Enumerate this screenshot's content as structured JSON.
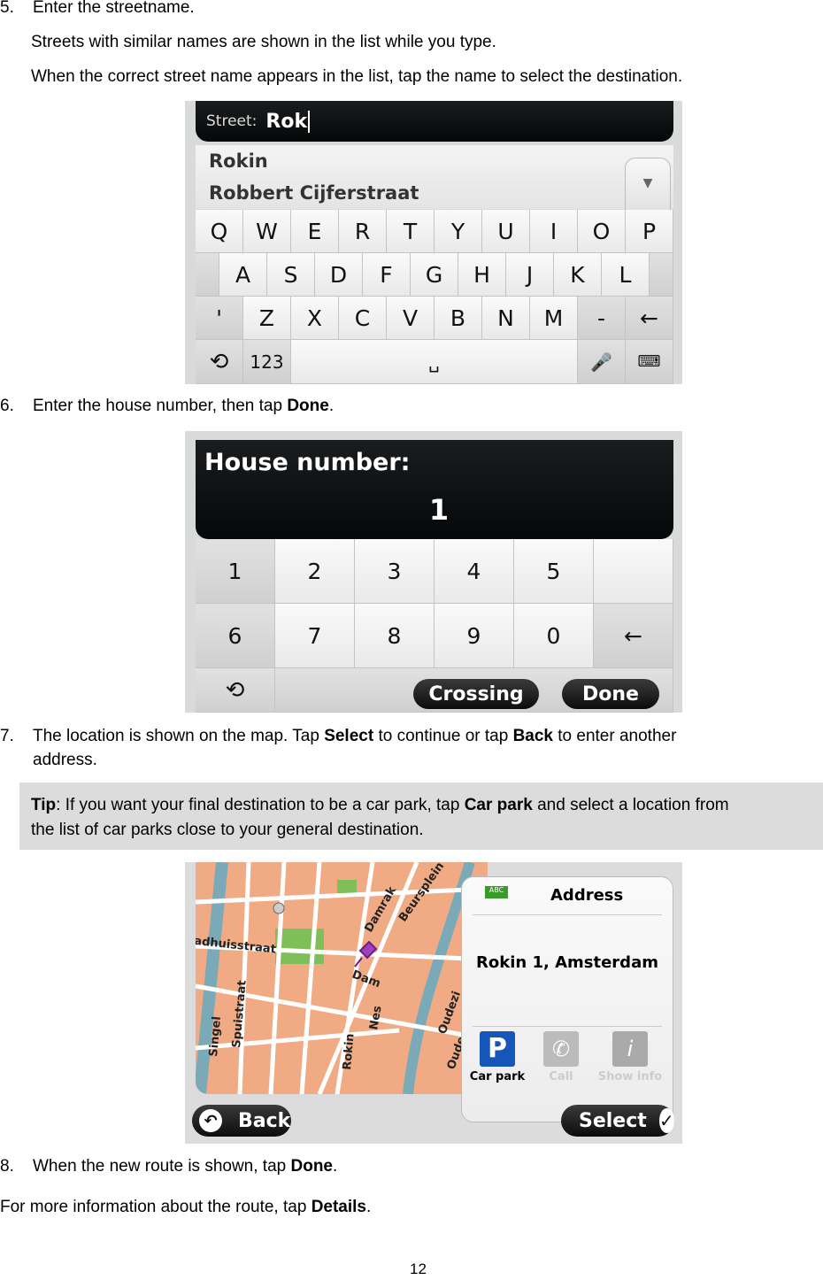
{
  "steps": [
    {
      "number": "5.",
      "text": "Enter the streetname."
    },
    {
      "number": "6.",
      "text_before": "Enter the house number, then tap ",
      "bold": "Done",
      "text_after": "."
    },
    {
      "number": "7.",
      "line1_a": "The location is shown on the map. Tap ",
      "line1_b": "Select",
      "line1_c": " to continue or tap ",
      "line1_d": "Back",
      "line1_e": " to enter another",
      "line2": "address."
    },
    {
      "number": "8.",
      "text_before": "When the new route is shown, tap ",
      "bold": "Done",
      "text_after": "."
    }
  ],
  "step5_notes": [
    "Streets with similar names are shown in the list while you type.",
    "When the correct street name appears in the list, tap the name to select the destination."
  ],
  "tip": {
    "label": "Tip",
    "a": ": If you want your final destination to be a car park, tap ",
    "b": "Car park",
    "c": " and select a location from",
    "line2": "the list of car parks close to your general destination."
  },
  "footer": {
    "a": "For more information about the route, tap ",
    "b": "Details",
    "c": "."
  },
  "page_number": "12",
  "screen_street": {
    "label": "Street:",
    "value": "Rok",
    "suggestions": [
      "Rokin",
      "Robbert Cijferstraat"
    ],
    "rows": [
      [
        "Q",
        "W",
        "E",
        "R",
        "T",
        "Y",
        "U",
        "I",
        "O",
        "P"
      ],
      [
        "A",
        "S",
        "D",
        "F",
        "G",
        "H",
        "J",
        "K",
        "L"
      ],
      [
        "'",
        "Z",
        "X",
        "C",
        "V",
        "B",
        "N",
        "M",
        "-"
      ]
    ],
    "numbers_key": "123",
    "icons": [
      "back-icon",
      "scroll-down-icon",
      "backspace-icon",
      "space-icon",
      "microphone-icon",
      "keyboard-icon"
    ]
  },
  "screen_house": {
    "label": "House number:",
    "value": "1",
    "keys": [
      "1",
      "2",
      "3",
      "4",
      "5",
      "6",
      "7",
      "8",
      "9",
      "0"
    ],
    "crossing": "Crossing",
    "done": "Done"
  },
  "screen_map": {
    "title": "Address",
    "address": "Rokin 1, Amsterdam",
    "actions": [
      "Car park",
      "Call",
      "Show info"
    ],
    "back": "Back",
    "select": "Select",
    "map_labels": [
      "adhuisstraat",
      "Damrak",
      "Beursplein",
      "Dam",
      "Nes",
      "Rokin",
      "Singel",
      "Spuistraat",
      "Oudezi",
      "Oude"
    ],
    "colors": {
      "blocks": "#f0ab85",
      "water": "#7aa9b8",
      "park": "#7fbf5a",
      "pin": "#a23fbf",
      "carpark": "#1556b8"
    }
  }
}
